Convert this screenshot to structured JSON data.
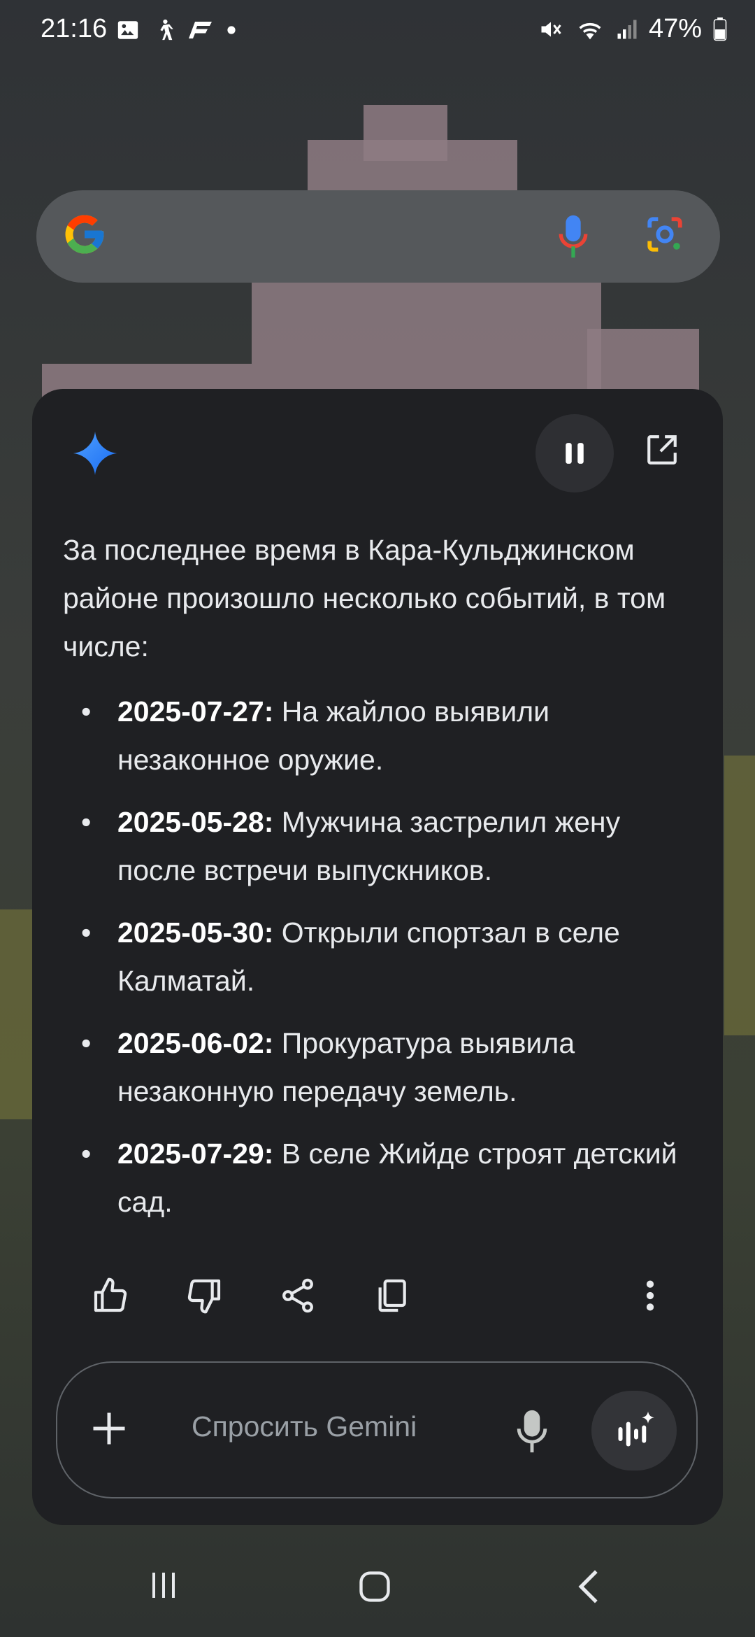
{
  "status_bar": {
    "time": "21:16",
    "battery": "47%",
    "left_icons": [
      "gallery-icon",
      "walking-icon",
      "app-icon",
      "dot-icon"
    ],
    "right_icons": [
      "mute-icon",
      "wifi-icon",
      "signal-icon",
      "battery-icon"
    ]
  },
  "search_bar": {
    "icons": [
      "google-logo-icon",
      "mic-icon",
      "lens-icon"
    ]
  },
  "gemini_card": {
    "intro": "За последнее время в Кара-Кульджинском районе произошло несколько событий, в том числе:",
    "items": [
      {
        "date": "2025-07-27:",
        "text": "На жайлоо выявили незаконное оружие."
      },
      {
        "date": "2025-05-28:",
        "text": "Мужчина застрелил жену после встречи выпускников."
      },
      {
        "date": "2025-05-30:",
        "text": "Открыли спортзал в селе Калматай."
      },
      {
        "date": "2025-06-02:",
        "text": "Прокуратура выявила незаконную передачу земель."
      },
      {
        "date": "2025-07-29:",
        "text": "В селе Жийде строят детский сад."
      }
    ],
    "input_placeholder": "Спросить Gemini"
  },
  "colors": {
    "card_bg": "#1f2023",
    "accent_blue": "#4285f4"
  }
}
